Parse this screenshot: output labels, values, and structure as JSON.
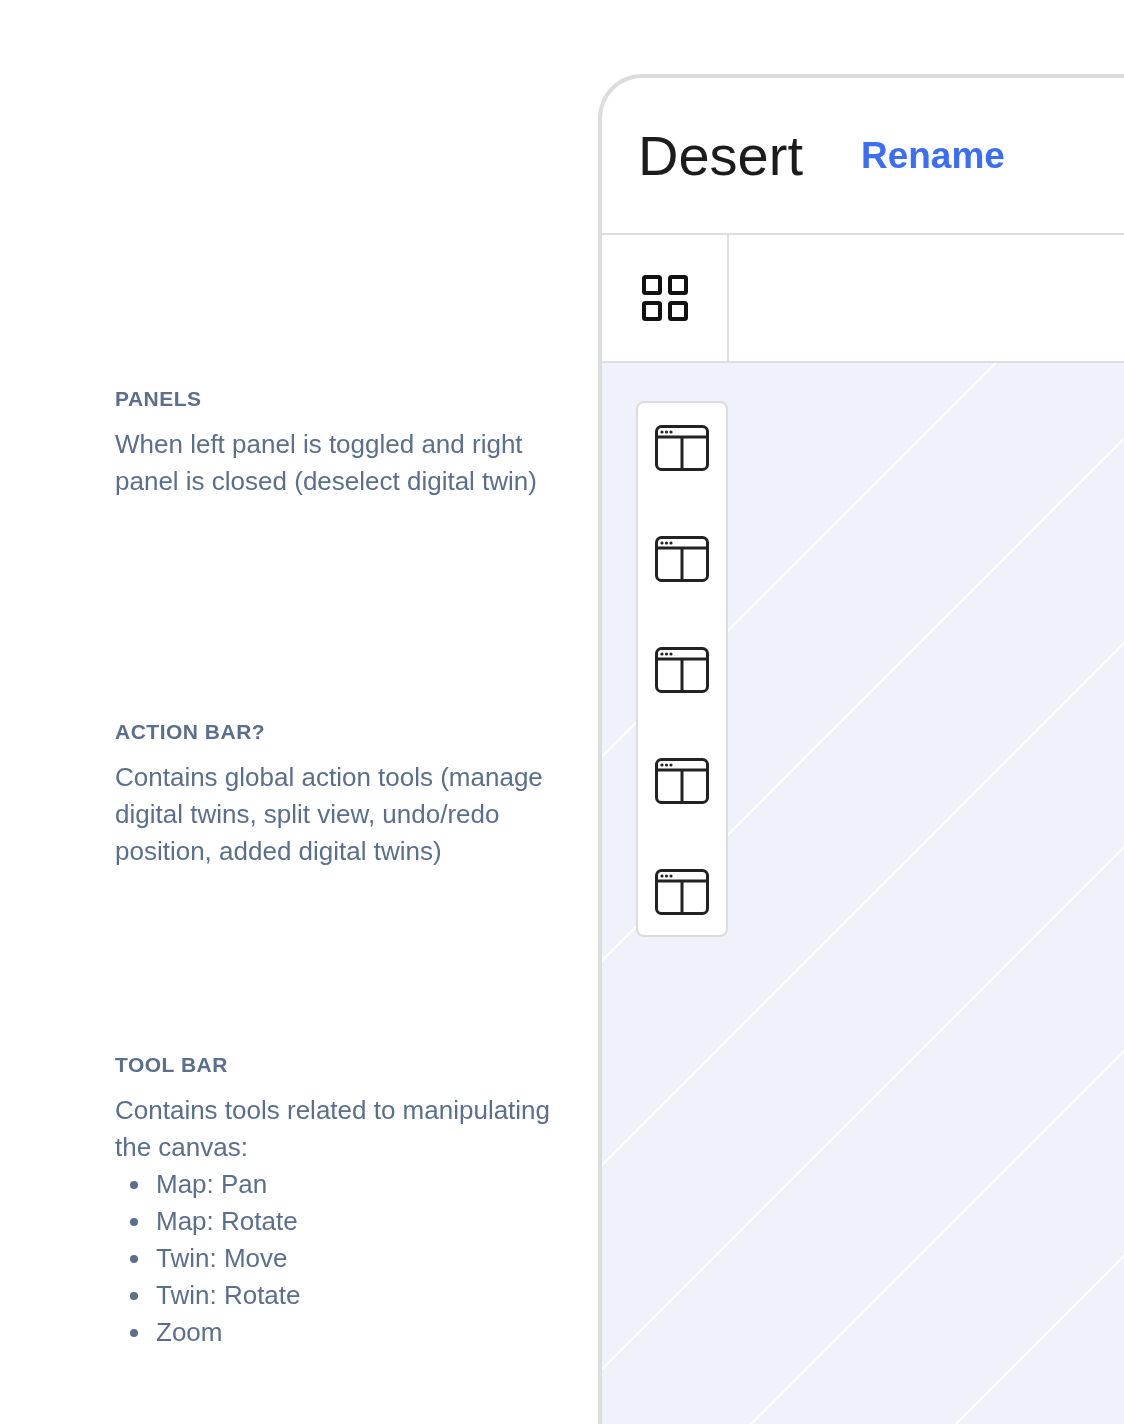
{
  "notes": [
    {
      "title": "PANELS",
      "body": "When left panel is toggled and right panel is closed (deselect digital twin)"
    },
    {
      "title": "ACTION BAR?",
      "body": "Contains global action tools (manage digital twins, split view, undo/redo position, added digital twins)"
    },
    {
      "title": "TOOL BAR",
      "body": "Contains tools related to manipulating the canvas:",
      "bullets": [
        "Map: Pan",
        "Map: Rotate",
        "Twin: Move",
        "Twin: Rotate",
        "Zoom"
      ]
    }
  ],
  "window": {
    "title": "Desert",
    "action": "Rename"
  },
  "toolbar": {
    "tools": [
      {
        "kind": "grid"
      }
    ]
  },
  "panel": {
    "buttons": [
      {
        "kind": "layout"
      },
      {
        "kind": "layout"
      },
      {
        "kind": "layout"
      },
      {
        "kind": "layout"
      },
      {
        "kind": "layout"
      }
    ]
  }
}
